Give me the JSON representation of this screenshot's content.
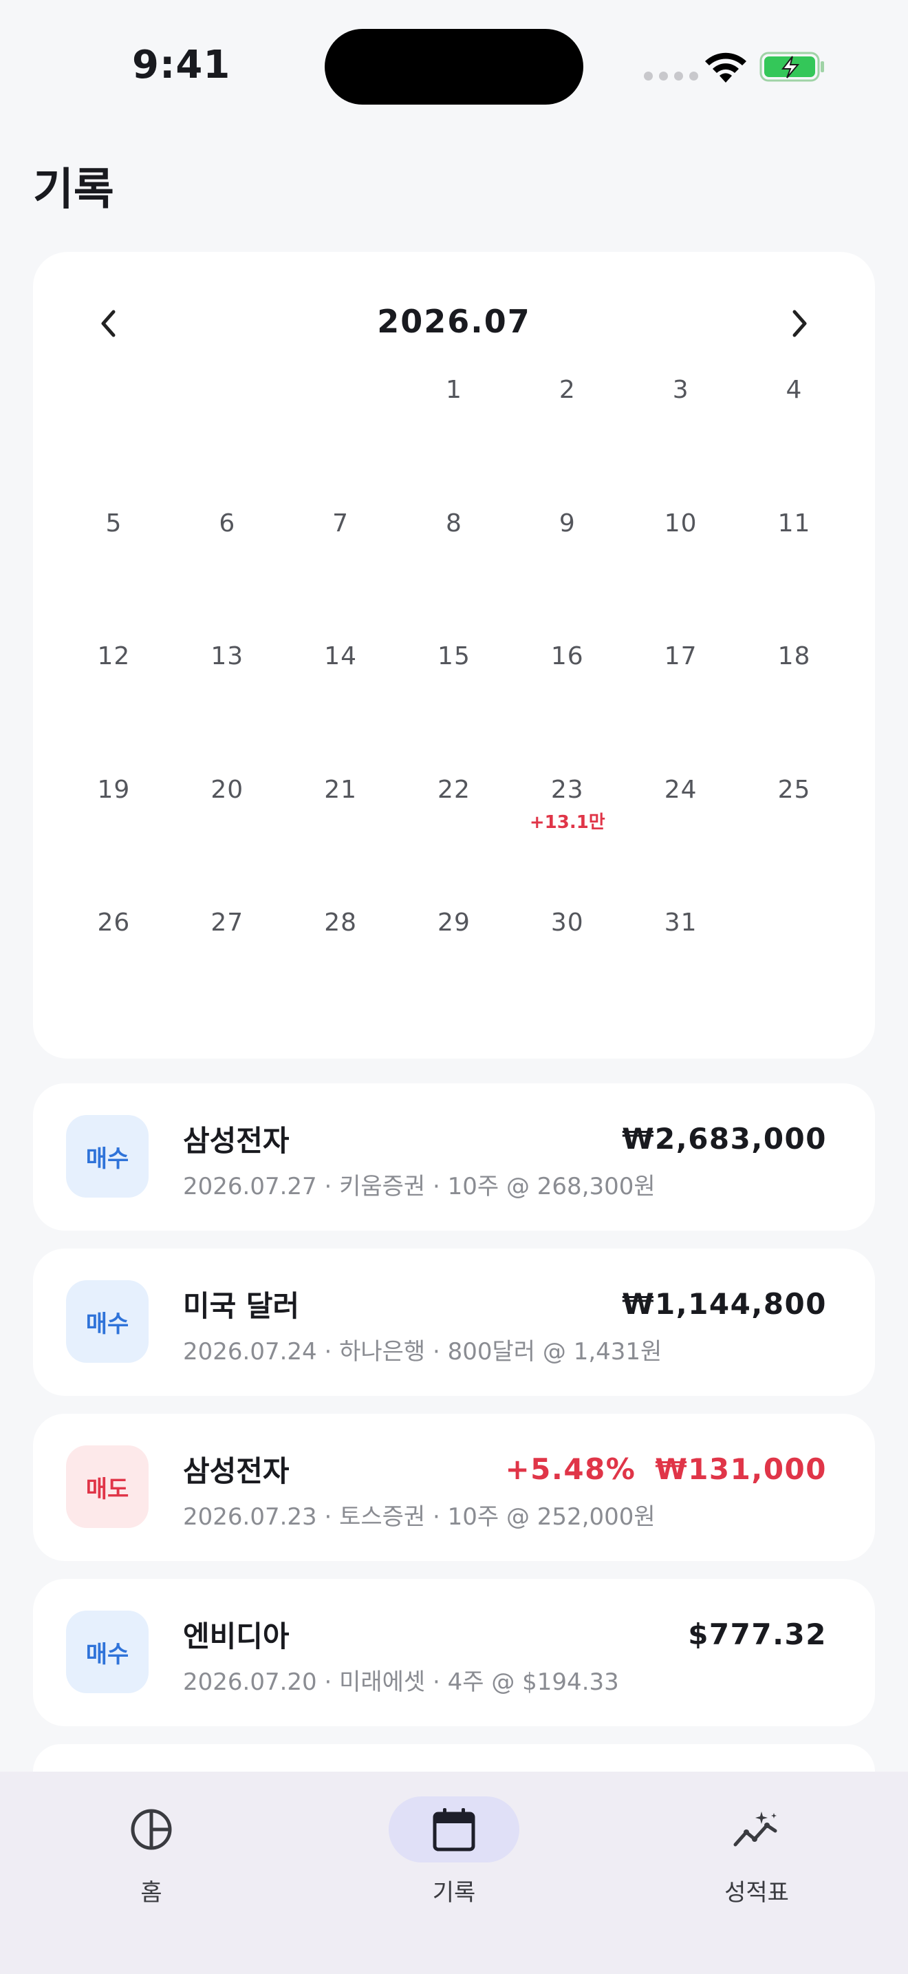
{
  "status": {
    "time": "9:41"
  },
  "page": {
    "title": "기록"
  },
  "calendar": {
    "month_label": "2026.07",
    "weeks": [
      [
        {
          "d": ""
        },
        {
          "d": ""
        },
        {
          "d": ""
        },
        {
          "d": "1"
        },
        {
          "d": "2"
        },
        {
          "d": "3"
        },
        {
          "d": "4"
        }
      ],
      [
        {
          "d": "5"
        },
        {
          "d": "6"
        },
        {
          "d": "7"
        },
        {
          "d": "8"
        },
        {
          "d": "9"
        },
        {
          "d": "10"
        },
        {
          "d": "11"
        }
      ],
      [
        {
          "d": "12"
        },
        {
          "d": "13"
        },
        {
          "d": "14"
        },
        {
          "d": "15"
        },
        {
          "d": "16"
        },
        {
          "d": "17"
        },
        {
          "d": "18"
        }
      ],
      [
        {
          "d": "19"
        },
        {
          "d": "20"
        },
        {
          "d": "21"
        },
        {
          "d": "22"
        },
        {
          "d": "23",
          "pl": "+13.1만"
        },
        {
          "d": "24"
        },
        {
          "d": "25"
        }
      ],
      [
        {
          "d": "26"
        },
        {
          "d": "27"
        },
        {
          "d": "28"
        },
        {
          "d": "29"
        },
        {
          "d": "30"
        },
        {
          "d": "31"
        },
        {
          "d": ""
        }
      ]
    ]
  },
  "transactions": [
    {
      "type": "buy",
      "badge": "매수",
      "name": "삼성전자",
      "detail": "2026.07.27 · 키움증권 · 10주 @ 268,300원",
      "pct": "",
      "amount": "₩2,683,000"
    },
    {
      "type": "buy",
      "badge": "매수",
      "name": "미국 달러",
      "detail": "2026.07.24 · 하나은행 · 800달러 @ 1,431원",
      "pct": "",
      "amount": "₩1,144,800"
    },
    {
      "type": "sell",
      "badge": "매도",
      "name": "삼성전자",
      "detail": "2026.07.23 · 토스증권 · 10주 @ 252,000원",
      "pct": "+5.48%",
      "amount": "₩131,000"
    },
    {
      "type": "buy",
      "badge": "매수",
      "name": "엔비디아",
      "detail": "2026.07.20 · 미래에셋 · 4주 @ $194.33",
      "pct": "",
      "amount": "$777.32"
    }
  ],
  "tabs": [
    {
      "key": "home",
      "label": "홈",
      "icon": "pie-chart-icon",
      "active": false
    },
    {
      "key": "record",
      "label": "기록",
      "icon": "calendar-icon",
      "active": true
    },
    {
      "key": "report",
      "label": "성적표",
      "icon": "sparkle-trend-icon",
      "active": false
    }
  ],
  "colors": {
    "accent_red": "#e03548",
    "accent_blue": "#2f73d9",
    "background": "#f6f7f9"
  }
}
